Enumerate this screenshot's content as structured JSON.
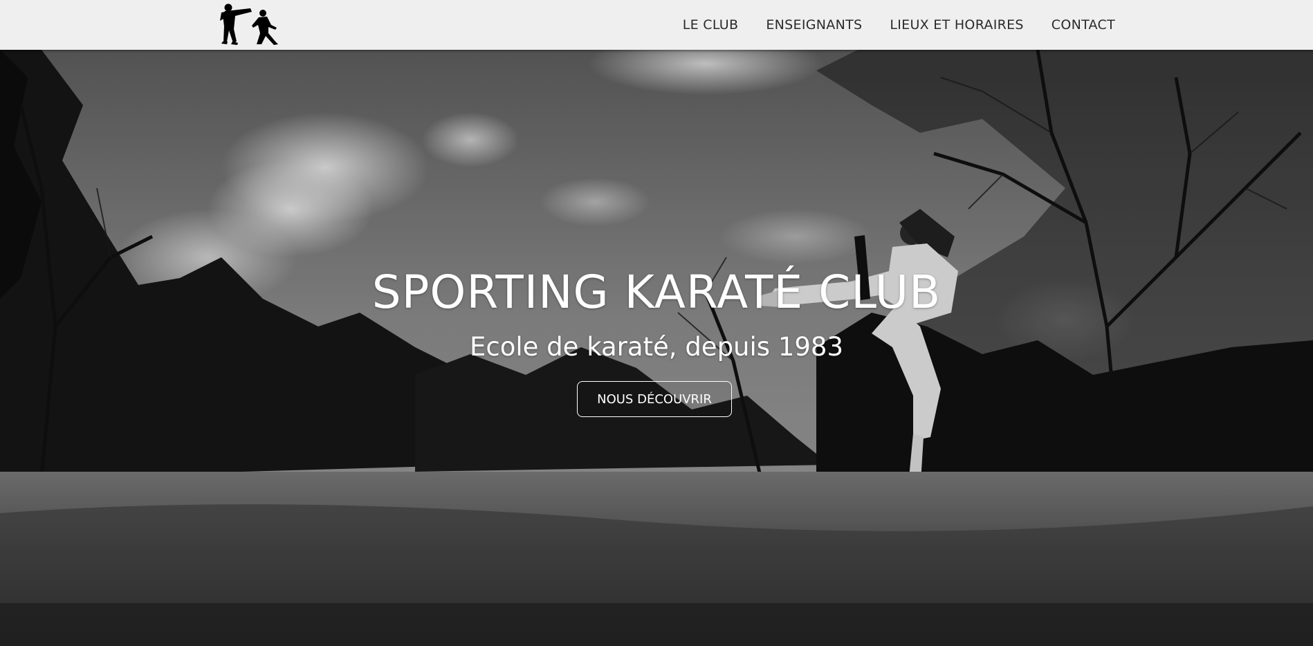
{
  "header": {
    "logo_icon": "karate-fighters-logo",
    "nav": [
      {
        "label": "LE CLUB"
      },
      {
        "label": "ENSEIGNANTS"
      },
      {
        "label": "LIEUX ET HORAIRES"
      },
      {
        "label": "CONTACT"
      }
    ]
  },
  "hero": {
    "title": "SPORTING KARATÉ CLUB",
    "subtitle": "Ecole de karaté, depuis 1983",
    "cta_label": "NOUS DÉCOUVRIR",
    "image": "karate-kick-photo-grayscale"
  },
  "colors": {
    "navbar_bg": "#efefef",
    "nav_text": "#2a2a2a",
    "hero_text": "#ffffff"
  }
}
